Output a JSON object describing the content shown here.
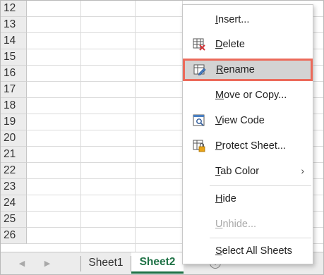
{
  "rows": [
    "12",
    "13",
    "14",
    "15",
    "16",
    "17",
    "18",
    "19",
    "20",
    "21",
    "22",
    "23",
    "24",
    "25",
    "26"
  ],
  "tabs": {
    "prev_arrow": "◀",
    "next_arrow": "▶",
    "sheets": [
      {
        "label": "Sheet1",
        "active": false
      },
      {
        "label": "Sheet2",
        "active": true
      }
    ],
    "add_sheet": "+"
  },
  "context_menu": {
    "items": [
      {
        "label": "Insert...",
        "mnemonic": "I",
        "icon": null,
        "state": "normal"
      },
      {
        "label": "Delete",
        "mnemonic": "D",
        "icon": "delete-sheet-icon",
        "state": "normal"
      },
      {
        "label": "Rename",
        "mnemonic": "R",
        "icon": "rename-sheet-icon",
        "state": "highlighted"
      },
      {
        "label": "Move or Copy...",
        "mnemonic": "M",
        "icon": null,
        "state": "normal"
      },
      {
        "label": "View Code",
        "mnemonic": "V",
        "icon": "view-code-icon",
        "state": "normal"
      },
      {
        "label": "Protect Sheet...",
        "mnemonic": "P",
        "icon": "protect-sheet-icon",
        "state": "normal"
      },
      {
        "label": "Tab Color",
        "mnemonic": "T",
        "icon": null,
        "state": "submenu"
      },
      {
        "label": "Hide",
        "mnemonic": "H",
        "icon": null,
        "state": "normal"
      },
      {
        "label": "Unhide...",
        "mnemonic": "U",
        "icon": null,
        "state": "disabled"
      },
      {
        "label": "Select All Sheets",
        "mnemonic": "S",
        "icon": null,
        "state": "normal"
      }
    ],
    "submenu_indicator": "›"
  },
  "colors": {
    "accent_green": "#1e7145",
    "highlight_outline": "#ec6a5a",
    "highlight_bg": "#d3d3d3"
  }
}
